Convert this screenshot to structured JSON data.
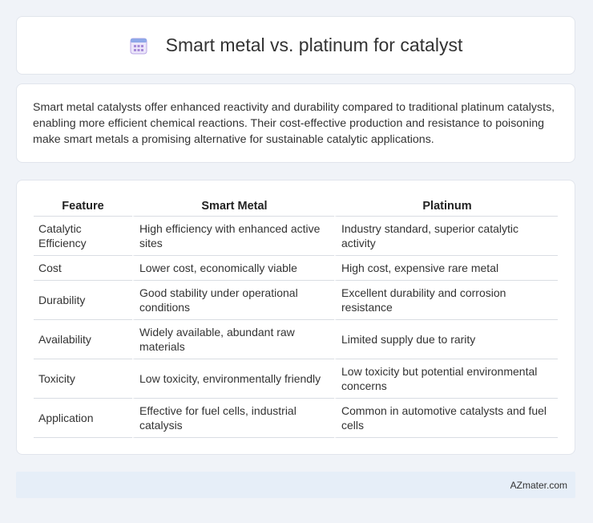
{
  "header": {
    "title": "Smart metal vs. platinum for catalyst",
    "icon": "calendar-icon"
  },
  "intro": "Smart metal catalysts offer enhanced reactivity and durability compared to traditional platinum catalysts, enabling more efficient chemical reactions. Their cost-effective production and resistance to poisoning make smart metals a promising alternative for sustainable catalytic applications.",
  "table": {
    "columns": [
      "Feature",
      "Smart Metal",
      "Platinum"
    ],
    "rows": [
      [
        "Catalytic Efficiency",
        "High efficiency with enhanced active sites",
        "Industry standard, superior catalytic activity"
      ],
      [
        "Cost",
        "Lower cost, economically viable",
        "High cost, expensive rare metal"
      ],
      [
        "Durability",
        "Good stability under operational conditions",
        "Excellent durability and corrosion resistance"
      ],
      [
        "Availability",
        "Widely available, abundant raw materials",
        "Limited supply due to rarity"
      ],
      [
        "Toxicity",
        "Low toxicity, environmentally friendly",
        "Low toxicity but potential environmental concerns"
      ],
      [
        "Application",
        "Effective for fuel cells, industrial catalysis",
        "Common in automotive catalysts and fuel cells"
      ]
    ]
  },
  "footer": {
    "site": "AZmater.com"
  },
  "colors": {
    "background": "#f0f3f8",
    "card": "#ffffff",
    "footer": "#e6eef8",
    "icon_accent": "#a78bd8"
  }
}
